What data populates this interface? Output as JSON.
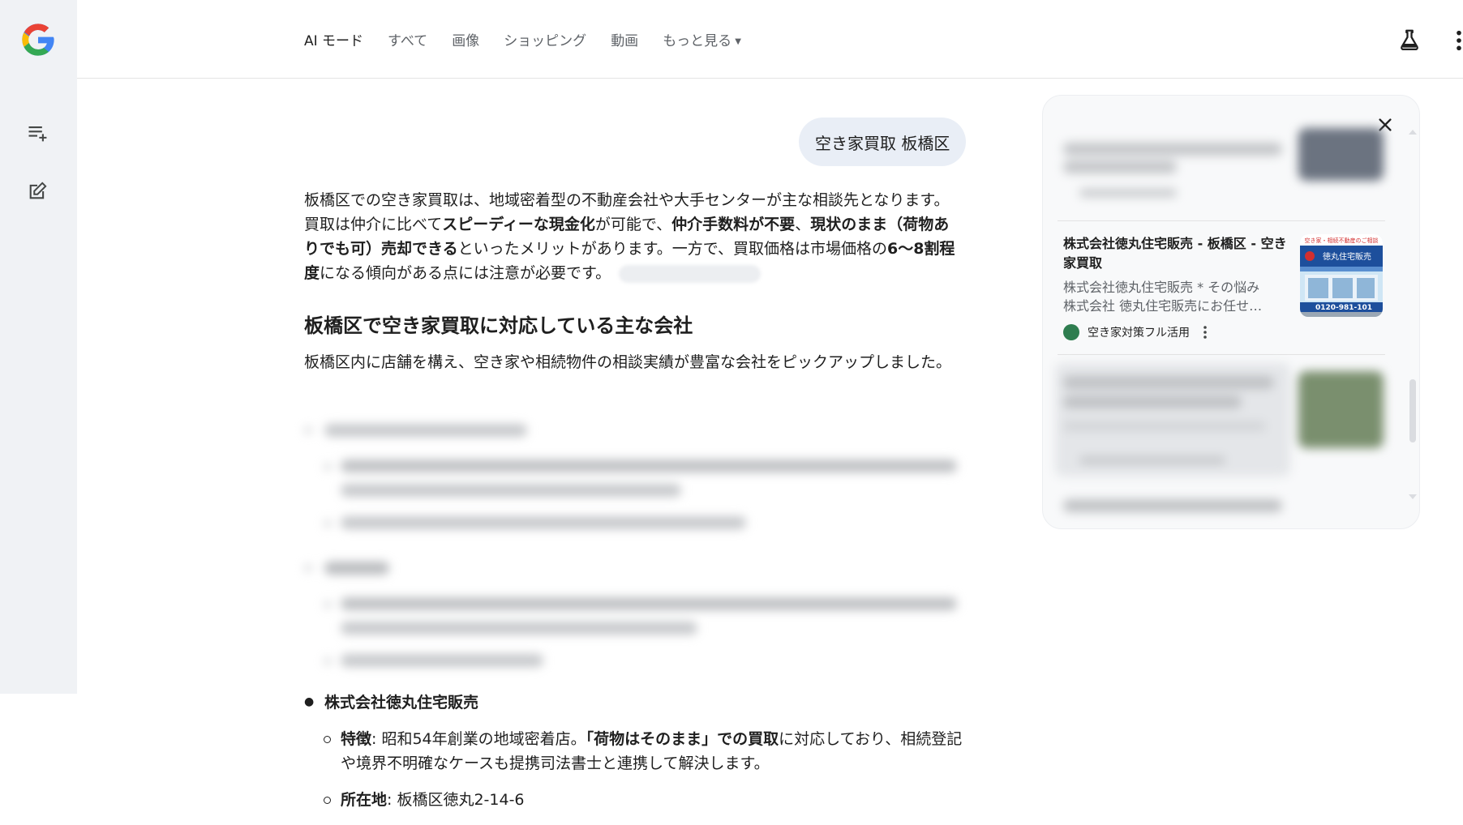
{
  "tabs": [
    {
      "label": "AI モード",
      "active": true
    },
    {
      "label": "すべて"
    },
    {
      "label": "画像"
    },
    {
      "label": "ショッピング"
    },
    {
      "label": "動画"
    },
    {
      "label": "もっと見る"
    }
  ],
  "query": "空き家買取 板橋区",
  "answer": {
    "p1_a": "板橋区での空き家買取は、地域密着型の不動産会社や大手センターが主な相談先となります。買取は仲介に比べて",
    "p1_b1": "スピーディーな現金化",
    "p1_c": "が可能で、",
    "p1_b2": "仲介手数料が不要",
    "p1_d": "、",
    "p1_b3": "現状のまま（荷物ありでも可）売却できる",
    "p1_e": "といったメリットがあります。一方で、買取価格は市場価格の",
    "p1_b4": "6〜8割程度",
    "p1_f": "になる傾向がある点には注意が必要です。"
  },
  "section": {
    "heading": "板橋区で空き家買取に対応している主な会社",
    "intro": "板橋区内に店舗を構え、空き家や相続物件の相談実績が豊富な会社をピックアップしました。"
  },
  "company": {
    "name": "株式会社徳丸住宅販売",
    "feature_label": "特徴",
    "feature_a": ": 昭和54年創業の地域密着店。",
    "feature_b": "「荷物はそのまま」での買取",
    "feature_c": "に対応しており、相続登記や境界不明確なケースも提携司法書士と連携して解決します。",
    "address_label": "所在地",
    "address_value": ": 板橋区徳丸2-14-6"
  },
  "panel": {
    "card": {
      "title": "株式会社徳丸住宅販売 - 板橋区 - 空き家買取",
      "snippet_1": "株式会社徳丸住宅販売 * その悩み",
      "snippet_2": "株式会社 徳丸住宅販売にお任せ…",
      "source": "空き家対策フル活用",
      "thumb_banner": "空き家・相続不動産のご相談",
      "thumb_sign": "徳丸住宅販売",
      "thumb_phone": "0120-981-101"
    }
  },
  "colors": {
    "rail_bg": "#f0f2f5",
    "bubble_bg": "#e9eef6",
    "panel_bg": "#f8f9fa"
  }
}
